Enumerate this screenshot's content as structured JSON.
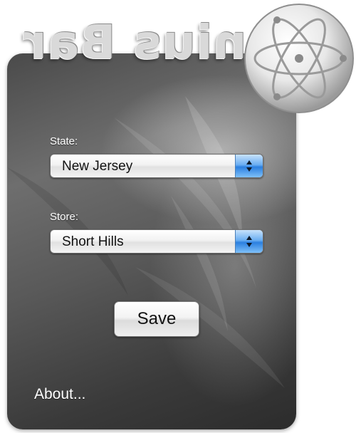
{
  "widget": {
    "title": "Genius Bar",
    "logo_icon": "atom-icon"
  },
  "form": {
    "state": {
      "label": "State:",
      "value": "New Jersey"
    },
    "store": {
      "label": "Store:",
      "value": "Short Hills"
    },
    "save_label": "Save"
  },
  "footer": {
    "about_label": "About..."
  },
  "colors": {
    "panel": "#4f4f4f",
    "popup_arrows": "#2b7fe0",
    "label_text": "#ffffff"
  }
}
